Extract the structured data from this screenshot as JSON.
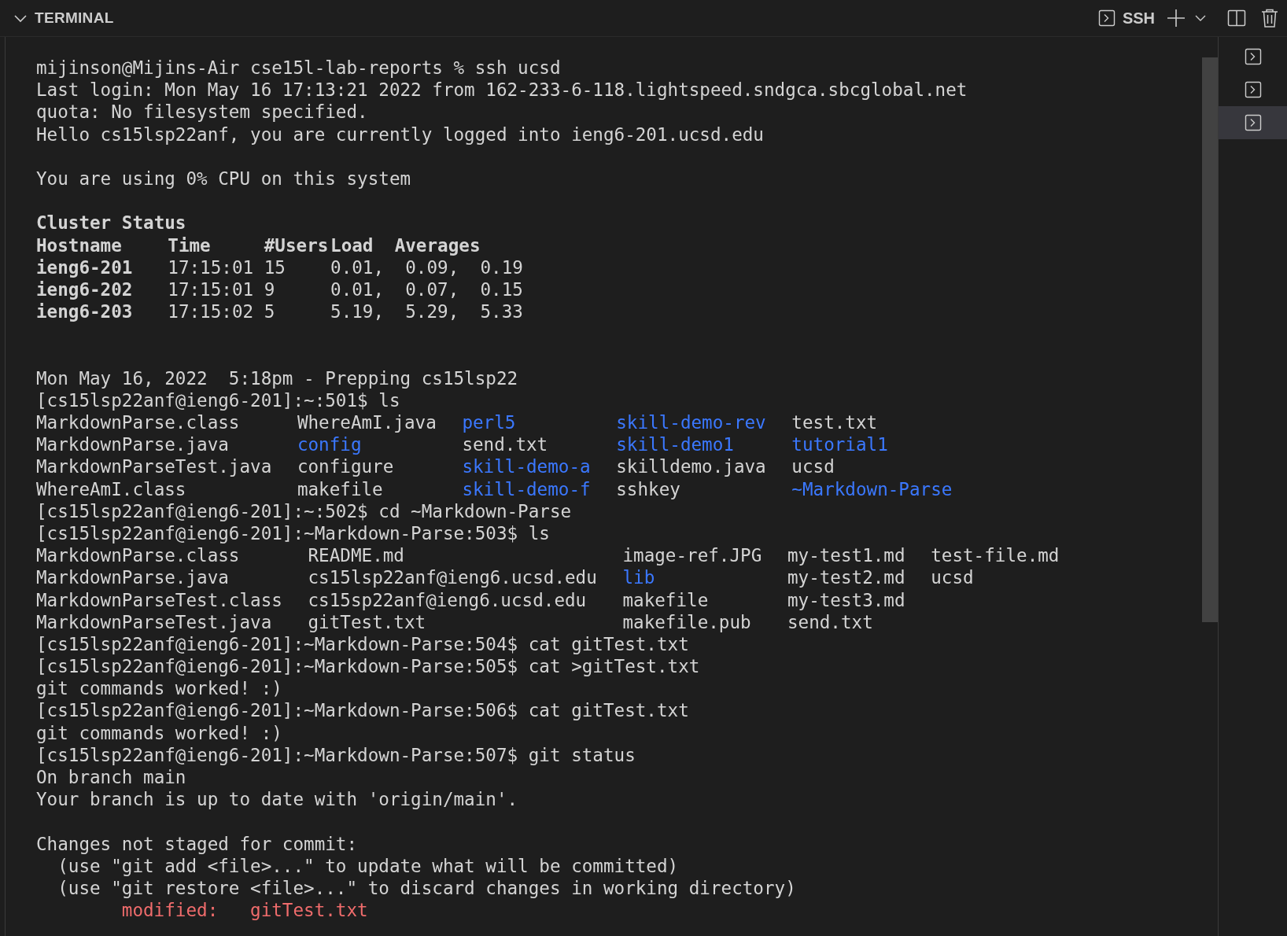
{
  "panel": {
    "title": "TERMINAL",
    "active_terminal": "SSH"
  },
  "terminals": [
    {
      "selected": false
    },
    {
      "selected": false
    },
    {
      "selected": true
    }
  ],
  "lines": [
    {
      "kind": "text",
      "text": "mijinson@Mijins-Air cse15l-lab-reports % ssh ucsd"
    },
    {
      "kind": "text",
      "text": "Last login: Mon May 16 17:13:21 2022 from 162-233-6-118.lightspeed.sndgca.sbcglobal.net"
    },
    {
      "kind": "text",
      "text": "quota: No filesystem specified."
    },
    {
      "kind": "text",
      "text": "Hello cs15lsp22anf, you are currently logged into ieng6-201.ucsd.edu"
    },
    {
      "kind": "blank"
    },
    {
      "kind": "text",
      "text": "You are using 0% CPU on this system"
    },
    {
      "kind": "blank"
    },
    {
      "kind": "heading",
      "text": "Cluster Status"
    },
    {
      "kind": "cluster_table",
      "rows": [
        [
          "Hostname",
          "Time",
          "#Users",
          "Load  Averages"
        ],
        [
          "ieng6-201",
          "17:15:01",
          "15",
          "0.01,  0.09,  0.19"
        ],
        [
          "ieng6-202",
          "17:15:01",
          "9",
          "0.01,  0.07,  0.15"
        ],
        [
          "ieng6-203",
          "17:15:02",
          "5",
          "5.19,  5.29,  5.33"
        ]
      ]
    },
    {
      "kind": "blank"
    },
    {
      "kind": "blank"
    },
    {
      "kind": "text",
      "text": "Mon May 16, 2022  5:18pm - Prepping cs15lsp22"
    },
    {
      "kind": "text",
      "text": "[cs15lsp22anf@ieng6-201]:~:501$ ls"
    },
    {
      "kind": "file_listing",
      "rows": [
        [
          {
            "text": "MarkdownParse.class",
            "kind": "file"
          },
          {
            "text": "WhereAmI.java",
            "kind": "file"
          },
          {
            "text": "perl5",
            "kind": "directory"
          },
          {
            "text": "skill-demo-rev",
            "kind": "directory"
          },
          {
            "text": "test.txt",
            "kind": "file"
          }
        ],
        [
          {
            "text": "MarkdownParse.java",
            "kind": "file"
          },
          {
            "text": "config",
            "kind": "directory"
          },
          {
            "text": "send.txt",
            "kind": "file"
          },
          {
            "text": "skill-demo1",
            "kind": "directory"
          },
          {
            "text": "tutorial1",
            "kind": "directory"
          }
        ],
        [
          {
            "text": "MarkdownParseTest.java",
            "kind": "file"
          },
          {
            "text": "configure",
            "kind": "file"
          },
          {
            "text": "skill-demo-a",
            "kind": "directory"
          },
          {
            "text": "skilldemo.java",
            "kind": "file"
          },
          {
            "text": "ucsd",
            "kind": "file"
          }
        ],
        [
          {
            "text": "WhereAmI.class",
            "kind": "file"
          },
          {
            "text": "makefile",
            "kind": "file"
          },
          {
            "text": "skill-demo-f",
            "kind": "directory"
          },
          {
            "text": "sshkey",
            "kind": "file"
          },
          {
            "text": "~Markdown-Parse",
            "kind": "directory"
          }
        ]
      ]
    },
    {
      "kind": "text",
      "text": "[cs15lsp22anf@ieng6-201]:~:502$ cd ~Markdown-Parse"
    },
    {
      "kind": "text",
      "text": "[cs15lsp22anf@ieng6-201]:~Markdown-Parse:503$ ls"
    },
    {
      "kind": "file_listing",
      "rows": [
        [
          {
            "text": "MarkdownParse.class",
            "kind": "file"
          },
          {
            "text": "README.md",
            "kind": "file"
          },
          {
            "text": "image-ref.JPG",
            "kind": "file"
          },
          {
            "text": "my-test1.md",
            "kind": "file"
          },
          {
            "text": "test-file.md",
            "kind": "file"
          }
        ],
        [
          {
            "text": "MarkdownParse.java",
            "kind": "file"
          },
          {
            "text": "cs15lsp22anf@ieng6.ucsd.edu",
            "kind": "file"
          },
          {
            "text": "lib",
            "kind": "directory"
          },
          {
            "text": "my-test2.md",
            "kind": "file"
          },
          {
            "text": "ucsd",
            "kind": "file"
          }
        ],
        [
          {
            "text": "MarkdownParseTest.class",
            "kind": "file"
          },
          {
            "text": "cs15sp22anf@ieng6.ucsd.edu",
            "kind": "file"
          },
          {
            "text": "makefile",
            "kind": "file"
          },
          {
            "text": "my-test3.md",
            "kind": "file"
          }
        ],
        [
          {
            "text": "MarkdownParseTest.java",
            "kind": "file"
          },
          {
            "text": "gitTest.txt",
            "kind": "file"
          },
          {
            "text": "makefile.pub",
            "kind": "file"
          },
          {
            "text": "send.txt",
            "kind": "file"
          }
        ]
      ]
    },
    {
      "kind": "text",
      "text": "[cs15lsp22anf@ieng6-201]:~Markdown-Parse:504$ cat gitTest.txt"
    },
    {
      "kind": "text",
      "text": "[cs15lsp22anf@ieng6-201]:~Markdown-Parse:505$ cat >gitTest.txt"
    },
    {
      "kind": "text",
      "text": "git commands worked! :)"
    },
    {
      "kind": "text",
      "text": "[cs15lsp22anf@ieng6-201]:~Markdown-Parse:506$ cat gitTest.txt"
    },
    {
      "kind": "text",
      "text": "git commands worked! :)"
    },
    {
      "kind": "text",
      "text": "[cs15lsp22anf@ieng6-201]:~Markdown-Parse:507$ git status"
    },
    {
      "kind": "text",
      "text": "On branch main"
    },
    {
      "kind": "text",
      "text": "Your branch is up to date with 'origin/main'."
    },
    {
      "kind": "blank"
    },
    {
      "kind": "text",
      "text": "Changes not staged for commit:"
    },
    {
      "kind": "hint",
      "text": "(use \"git add <file>...\" to update what will be committed)"
    },
    {
      "kind": "hint",
      "text": "(use \"git restore <file>...\" to discard changes in working directory)"
    },
    {
      "kind": "status_entry",
      "label": "modified:",
      "file": "gitTest.txt"
    }
  ]
}
